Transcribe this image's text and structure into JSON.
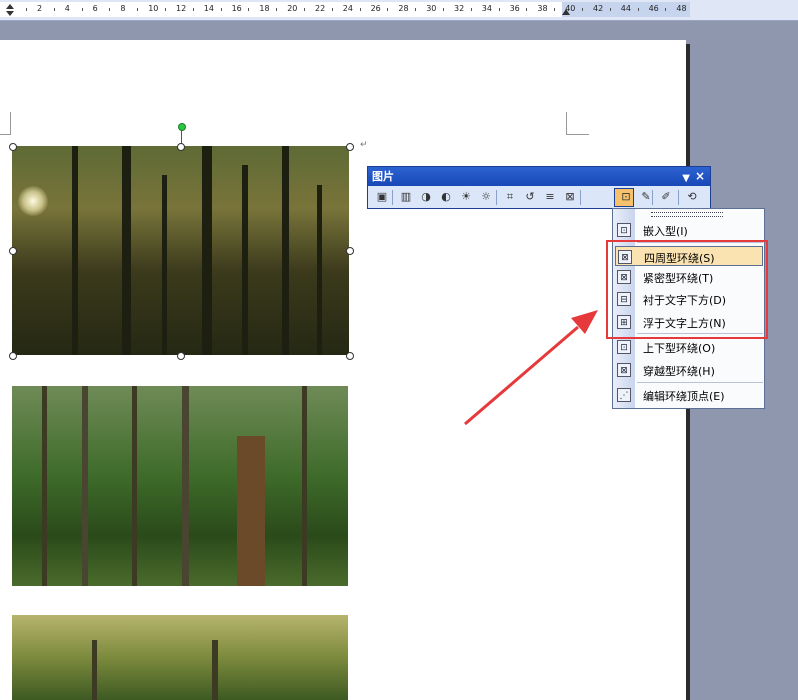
{
  "ruler": {
    "numbers": [
      "2",
      "4",
      "6",
      "8",
      "10",
      "12",
      "14",
      "16",
      "18",
      "20",
      "22",
      "24",
      "26",
      "28",
      "30",
      "32",
      "34",
      "36",
      "38",
      "40",
      "42",
      "44",
      "46",
      "48"
    ]
  },
  "picture_toolbar": {
    "title": "图片",
    "menu_arrow": "▼",
    "close": "×",
    "buttons": [
      {
        "icon": "insert-picture-icon",
        "glyph": "▣"
      },
      {
        "icon": "color-icon",
        "glyph": "▥"
      },
      {
        "icon": "more-contrast-icon",
        "glyph": "◑"
      },
      {
        "icon": "less-contrast-icon",
        "glyph": "◐"
      },
      {
        "icon": "more-brightness-icon",
        "glyph": "☀"
      },
      {
        "icon": "less-brightness-icon",
        "glyph": "☼"
      },
      {
        "icon": "crop-icon",
        "glyph": "⌗"
      },
      {
        "icon": "rotate-left-icon",
        "glyph": "↺"
      },
      {
        "icon": "line-style-icon",
        "glyph": "≡"
      },
      {
        "icon": "compress-pictures-icon",
        "glyph": "⊠"
      },
      {
        "icon": "text-wrapping-icon",
        "glyph": "⊡"
      },
      {
        "icon": "format-picture-icon",
        "glyph": "✎"
      },
      {
        "icon": "set-transparent-color-icon",
        "glyph": "✐"
      },
      {
        "icon": "reset-picture-icon",
        "glyph": "⟲"
      }
    ]
  },
  "wrap_menu": {
    "items": [
      {
        "label": "嵌入型(I)"
      },
      {
        "label": "四周型环绕(S)"
      },
      {
        "label": "紧密型环绕(T)"
      },
      {
        "label": "衬于文字下方(D)"
      },
      {
        "label": "浮于文字上方(N)"
      },
      {
        "label": "上下型环绕(O)"
      },
      {
        "label": "穿越型环绕(H)"
      },
      {
        "label": "编辑环绕顶点(E)"
      }
    ],
    "highlighted_index": 1
  },
  "document": {
    "paragraph_mark": "↵"
  },
  "colors": {
    "highlight_box": "#e5393b",
    "arrow": "#e5393b",
    "toolbar_title": "#1847b8"
  }
}
